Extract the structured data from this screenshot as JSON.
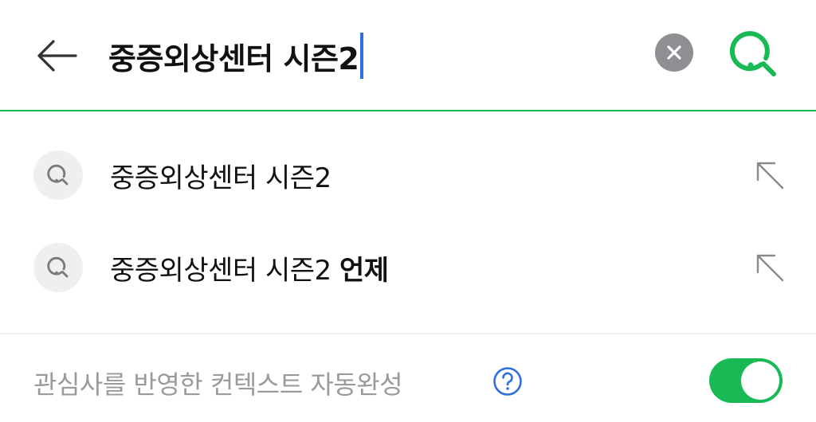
{
  "search": {
    "query": "중증외상센터 시즌2",
    "back_icon": "arrow-left-icon",
    "clear_icon": "close-circle-icon",
    "search_icon": "search-icon",
    "accent_color": "#19b955",
    "caret_color": "#2f6fe0"
  },
  "suggestions": [
    {
      "prefix": "중증외상센터 시즌2",
      "suffix": "",
      "icon": "search-icon",
      "fill_icon": "arrow-up-left-icon"
    },
    {
      "prefix": "중증외상센터 시즌2 ",
      "suffix": "언제",
      "icon": "search-icon",
      "fill_icon": "arrow-up-left-icon"
    }
  ],
  "autocomplete": {
    "label": "관심사를 반영한 컨텍스트 자동완성",
    "help_icon": "question-circle-icon",
    "toggle_on": true,
    "help_color": "#2f6fe0"
  }
}
